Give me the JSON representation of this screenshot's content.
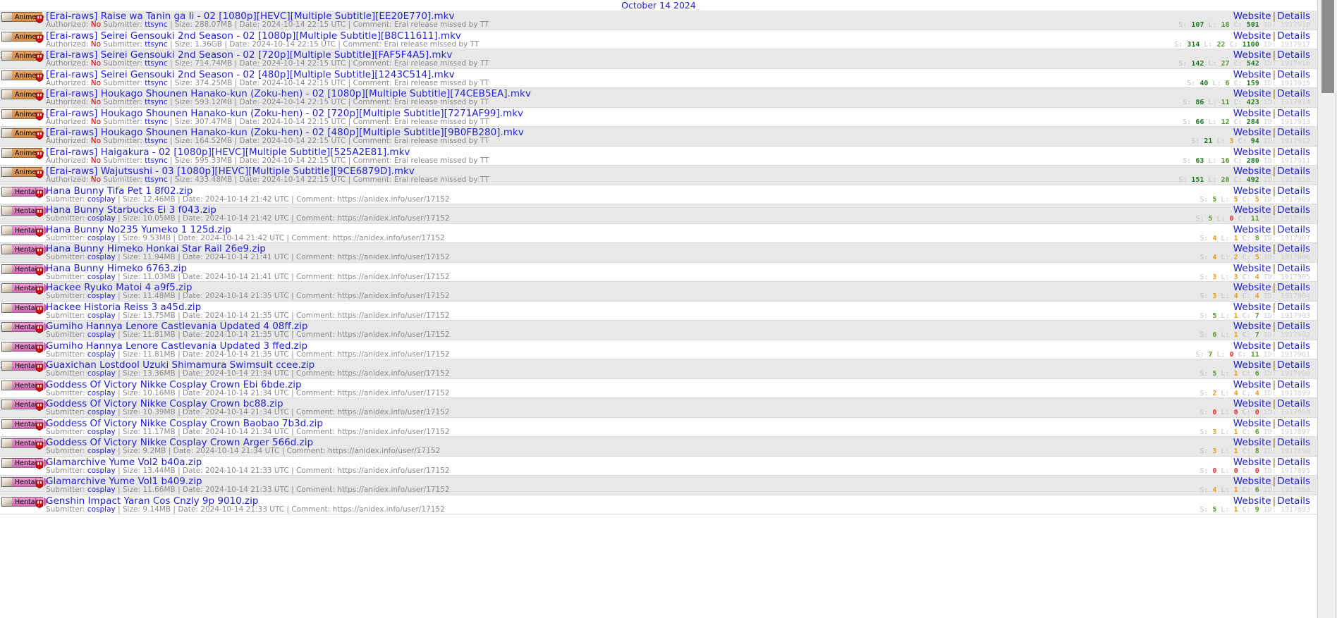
{
  "header": {
    "date": "October 14 2024"
  },
  "labels": {
    "authorized": "Authorized:",
    "submitter": "Submitter:",
    "size": "Size:",
    "date": "Date:",
    "comment": "Comment:",
    "website": "Website",
    "details": "Details",
    "separator": "|",
    "stat_s": "S:",
    "stat_l": "L:",
    "stat_c": "C:",
    "stat_id": "ID:",
    "shield_icon": "shield-icon",
    "category_image": "category-thumbnail"
  },
  "colors": {
    "link": "#2222dd",
    "meta": "#8a8a8a",
    "denied": "#cc0000",
    "anime_badge": "#d28a43",
    "hentai_badge": "#d069b3",
    "seed_high": "#1f7a1f",
    "seed_low": "#e89b18",
    "seed_zero": "#e03030",
    "row_alt": "#e8e8e8"
  },
  "rows": [
    {
      "category": "Anime",
      "title": "[Erai-raws] Raise wa Tanin ga Ii - 02 [1080p][HEVC][Multiple Subtitle][EE20E770].mkv",
      "authorized": "No",
      "submitter": "ttsync",
      "size": "288.07MB",
      "date": "2024-10-14 22:15 UTC",
      "comment": "Erai release missed by TT",
      "s": "107",
      "l": "18",
      "c": "501",
      "id": "1917918",
      "s_cls": "s-hi",
      "l_cls": "s-mid",
      "c_cls": "s-hi"
    },
    {
      "category": "Anime",
      "title": "[Erai-raws] Seirei Gensouki 2nd Season - 02 [1080p][Multiple Subtitle][B8C11611].mkv",
      "authorized": "No",
      "submitter": "ttsync",
      "size": "1.36GB",
      "date": "2024-10-14 22:15 UTC",
      "comment": "Erai release missed by TT",
      "s": "314",
      "l": "22",
      "c": "1100",
      "id": "1917917",
      "s_cls": "s-hi",
      "l_cls": "s-mid",
      "c_cls": "s-hi"
    },
    {
      "category": "Anime",
      "title": "[Erai-raws] Seirei Gensouki 2nd Season - 02 [720p][Multiple Subtitle][FAF5F4A5].mkv",
      "authorized": "No",
      "submitter": "ttsync",
      "size": "714.74MB",
      "date": "2024-10-14 22:15 UTC",
      "comment": "Erai release missed by TT",
      "s": "142",
      "l": "27",
      "c": "542",
      "id": "1917916",
      "s_cls": "s-hi",
      "l_cls": "s-mid",
      "c_cls": "s-hi"
    },
    {
      "category": "Anime",
      "title": "[Erai-raws] Seirei Gensouki 2nd Season - 02 [480p][Multiple Subtitle][1243C514].mkv",
      "authorized": "No",
      "submitter": "ttsync",
      "size": "374.25MB",
      "date": "2024-10-14 22:15 UTC",
      "comment": "Erai release missed by TT",
      "s": "40",
      "l": "6",
      "c": "159",
      "id": "1917915",
      "s_cls": "s-hi",
      "l_cls": "s-mid",
      "c_cls": "s-hi"
    },
    {
      "category": "Anime",
      "title": "[Erai-raws] Houkago Shounen Hanako-kun (Zoku-hen) - 02 [1080p][Multiple Subtitle][74CEB5EA].mkv",
      "authorized": "No",
      "submitter": "ttsync",
      "size": "593.12MB",
      "date": "2024-10-14 22:15 UTC",
      "comment": "Erai release missed by TT",
      "s": "86",
      "l": "11",
      "c": "423",
      "id": "1917914",
      "s_cls": "s-hi",
      "l_cls": "s-mid",
      "c_cls": "s-hi"
    },
    {
      "category": "Anime",
      "title": "[Erai-raws] Houkago Shounen Hanako-kun (Zoku-hen) - 02 [720p][Multiple Subtitle][7271AF99].mkv",
      "authorized": "No",
      "submitter": "ttsync",
      "size": "307.47MB",
      "date": "2024-10-14 22:15 UTC",
      "comment": "Erai release missed by TT",
      "s": "66",
      "l": "12",
      "c": "284",
      "id": "1917913",
      "s_cls": "s-hi",
      "l_cls": "s-mid",
      "c_cls": "s-hi"
    },
    {
      "category": "Anime",
      "title": "[Erai-raws] Houkago Shounen Hanako-kun (Zoku-hen) - 02 [480p][Multiple Subtitle][9B0FB280].mkv",
      "authorized": "No",
      "submitter": "ttsync",
      "size": "164.52MB",
      "date": "2024-10-14 22:15 UTC",
      "comment": "Erai release missed by TT",
      "s": "21",
      "l": "3",
      "c": "94",
      "id": "1917912",
      "s_cls": "s-hi",
      "l_cls": "s-low",
      "c_cls": "s-hi"
    },
    {
      "category": "Anime",
      "title": "[Erai-raws] Haigakura - 02 [1080p][HEVC][Multiple Subtitle][525A2E81].mkv",
      "authorized": "No",
      "submitter": "ttsync",
      "size": "595.33MB",
      "date": "2024-10-14 22:15 UTC",
      "comment": "Erai release missed by TT",
      "s": "63",
      "l": "16",
      "c": "280",
      "id": "1917911",
      "s_cls": "s-hi",
      "l_cls": "s-mid",
      "c_cls": "s-hi"
    },
    {
      "category": "Anime",
      "title": "[Erai-raws] Wajutsushi - 03 [1080p][HEVC][Multiple Subtitle][9CE6879D].mkv",
      "authorized": "No",
      "submitter": "ttsync",
      "size": "433.48MB",
      "date": "2024-10-14 22:15 UTC",
      "comment": "Erai release missed by TT",
      "s": "151",
      "l": "28",
      "c": "492",
      "id": "1917910",
      "s_cls": "s-hi",
      "l_cls": "s-mid",
      "c_cls": "s-hi"
    },
    {
      "category": "Hentai",
      "title": "Hana Bunny Tifa Pet 1 8f02.zip",
      "authorized": null,
      "submitter": "cosplay",
      "size": "12.46MB",
      "date": "2024-10-14 21:42 UTC",
      "comment": "https://anidex.info/user/17152",
      "s": "5",
      "l": "5",
      "c": "5",
      "id": "1917909",
      "s_cls": "s-mid",
      "l_cls": "s-low",
      "c_cls": "s-low"
    },
    {
      "category": "Hentai",
      "title": "Hana Bunny Starbucks Ei 3 f043.zip",
      "authorized": null,
      "submitter": "cosplay",
      "size": "10.05MB",
      "date": "2024-10-14 21:42 UTC",
      "comment": "https://anidex.info/user/17152",
      "s": "5",
      "l": "0",
      "c": "11",
      "id": "1917908",
      "s_cls": "s-mid",
      "l_cls": "s-zero",
      "c_cls": "s-mid"
    },
    {
      "category": "Hentai",
      "title": "Hana Bunny No235 Yumeko 1 125d.zip",
      "authorized": null,
      "submitter": "cosplay",
      "size": "9.53MB",
      "date": "2024-10-14 21:42 UTC",
      "comment": "https://anidex.info/user/17152",
      "s": "4",
      "l": "1",
      "c": "8",
      "id": "1917907",
      "s_cls": "s-low",
      "l_cls": "s-low",
      "c_cls": "s-mid"
    },
    {
      "category": "Hentai",
      "title": "Hana Bunny Himeko Honkai Star Rail 26e9.zip",
      "authorized": null,
      "submitter": "cosplay",
      "size": "11.94MB",
      "date": "2024-10-14 21:41 UTC",
      "comment": "https://anidex.info/user/17152",
      "s": "4",
      "l": "2",
      "c": "5",
      "id": "1917906",
      "s_cls": "s-low",
      "l_cls": "s-low",
      "c_cls": "s-low"
    },
    {
      "category": "Hentai",
      "title": "Hana Bunny Himeko 6763.zip",
      "authorized": null,
      "submitter": "cosplay",
      "size": "11.03MB",
      "date": "2024-10-14 21:41 UTC",
      "comment": "https://anidex.info/user/17152",
      "s": "3",
      "l": "3",
      "c": "4",
      "id": "1917905",
      "s_cls": "s-low",
      "l_cls": "s-low",
      "c_cls": "s-low"
    },
    {
      "category": "Hentai",
      "title": "Hackee Ryuko Matoi 4 a9f5.zip",
      "authorized": null,
      "submitter": "cosplay",
      "size": "11.48MB",
      "date": "2024-10-14 21:35 UTC",
      "comment": "https://anidex.info/user/17152",
      "s": "3",
      "l": "4",
      "c": "4",
      "id": "1917904",
      "s_cls": "s-low",
      "l_cls": "s-low",
      "c_cls": "s-low"
    },
    {
      "category": "Hentai",
      "title": "Hackee Historia Reiss 3 a45d.zip",
      "authorized": null,
      "submitter": "cosplay",
      "size": "13.75MB",
      "date": "2024-10-14 21:35 UTC",
      "comment": "https://anidex.info/user/17152",
      "s": "5",
      "l": "1",
      "c": "7",
      "id": "1917903",
      "s_cls": "s-mid",
      "l_cls": "s-low",
      "c_cls": "s-mid"
    },
    {
      "category": "Hentai",
      "title": "Gumiho Hannya Lenore Castlevania Updated 4 08ff.zip",
      "authorized": null,
      "submitter": "cosplay",
      "size": "11.81MB",
      "date": "2024-10-14 21:35 UTC",
      "comment": "https://anidex.info/user/17152",
      "s": "6",
      "l": "1",
      "c": "7",
      "id": "1917902",
      "s_cls": "s-mid",
      "l_cls": "s-low",
      "c_cls": "s-mid"
    },
    {
      "category": "Hentai",
      "title": "Gumiho Hannya Lenore Castlevania Updated 3 ffed.zip",
      "authorized": null,
      "submitter": "cosplay",
      "size": "11.81MB",
      "date": "2024-10-14 21:35 UTC",
      "comment": "https://anidex.info/user/17152",
      "s": "7",
      "l": "0",
      "c": "11",
      "id": "1917901",
      "s_cls": "s-mid",
      "l_cls": "s-zero",
      "c_cls": "s-mid"
    },
    {
      "category": "Hentai",
      "title": "Guaxichan Lostdool Uzuki Shimamura Swimsuit ccee.zip",
      "authorized": null,
      "submitter": "cosplay",
      "size": "13.36MB",
      "date": "2024-10-14 21:34 UTC",
      "comment": "https://anidex.info/user/17152",
      "s": "5",
      "l": "1",
      "c": "6",
      "id": "1917900",
      "s_cls": "s-mid",
      "l_cls": "s-low",
      "c_cls": "s-mid"
    },
    {
      "category": "Hentai",
      "title": "Goddess Of Victory Nikke Cosplay Crown Ebi 6bde.zip",
      "authorized": null,
      "submitter": "cosplay",
      "size": "10.16MB",
      "date": "2024-10-14 21:34 UTC",
      "comment": "https://anidex.info/user/17152",
      "s": "2",
      "l": "4",
      "c": "4",
      "id": "1917899",
      "s_cls": "s-low",
      "l_cls": "s-low",
      "c_cls": "s-low"
    },
    {
      "category": "Hentai",
      "title": "Goddess Of Victory Nikke Cosplay Crown bc88.zip",
      "authorized": null,
      "submitter": "cosplay",
      "size": "10.39MB",
      "date": "2024-10-14 21:34 UTC",
      "comment": "https://anidex.info/user/17152",
      "s": "0",
      "l": "0",
      "c": "0",
      "id": "1917898",
      "s_cls": "s-zero",
      "l_cls": "s-zero",
      "c_cls": "s-zero"
    },
    {
      "category": "Hentai",
      "title": "Goddess Of Victory Nikke Cosplay Crown Baobao 7b3d.zip",
      "authorized": null,
      "submitter": "cosplay",
      "size": "11.17MB",
      "date": "2024-10-14 21:34 UTC",
      "comment": "https://anidex.info/user/17152",
      "s": "3",
      "l": "1",
      "c": "6",
      "id": "1917897",
      "s_cls": "s-low",
      "l_cls": "s-low",
      "c_cls": "s-mid"
    },
    {
      "category": "Hentai",
      "title": "Goddess Of Victory Nikke Cosplay Crown Arger 566d.zip",
      "authorized": null,
      "submitter": "cosplay",
      "size": "9.2MB",
      "date": "2024-10-14 21:34 UTC",
      "comment": "https://anidex.info/user/17152",
      "s": "3",
      "l": "1",
      "c": "8",
      "id": "1917896",
      "s_cls": "s-low",
      "l_cls": "s-low",
      "c_cls": "s-mid"
    },
    {
      "category": "Hentai",
      "title": "Glamarchive Yume Vol2 b40a.zip",
      "authorized": null,
      "submitter": "cosplay",
      "size": "13.44MB",
      "date": "2024-10-14 21:33 UTC",
      "comment": "https://anidex.info/user/17152",
      "s": "0",
      "l": "0",
      "c": "0",
      "id": "1917895",
      "s_cls": "s-zero",
      "l_cls": "s-zero",
      "c_cls": "s-zero"
    },
    {
      "category": "Hentai",
      "title": "Glamarchive Yume Vol1 b409.zip",
      "authorized": null,
      "submitter": "cosplay",
      "size": "11.66MB",
      "date": "2024-10-14 21:33 UTC",
      "comment": "https://anidex.info/user/17152",
      "s": "4",
      "l": "1",
      "c": "6",
      "id": "1917894",
      "s_cls": "s-low",
      "l_cls": "s-low",
      "c_cls": "s-mid"
    },
    {
      "category": "Hentai",
      "title": "Genshin Impact Yaran Cos Cnzly 9p 9010.zip",
      "authorized": null,
      "submitter": "cosplay",
      "size": "9.14MB",
      "date": "2024-10-14 21:33 UTC",
      "comment": "https://anidex.info/user/17152",
      "s": "5",
      "l": "1",
      "c": "9",
      "id": "1917893",
      "s_cls": "s-mid",
      "l_cls": "s-low",
      "c_cls": "s-mid"
    }
  ]
}
